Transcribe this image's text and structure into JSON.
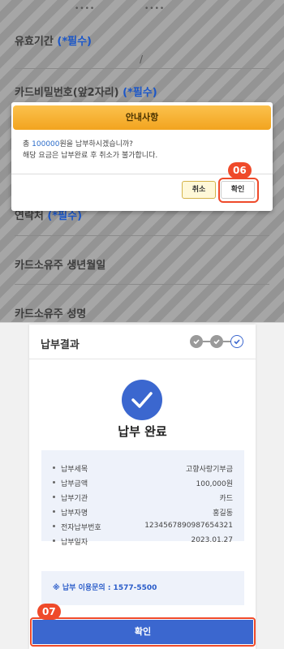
{
  "background_form": {
    "masked_values": [
      "••••",
      "••••"
    ],
    "fields": [
      {
        "label": "유효기간",
        "required": "(*필수)"
      },
      {
        "label": "카드비밀번호(앞2자리)",
        "required": "(*필수)"
      },
      {
        "label": "연락처",
        "required": "(*필수)"
      },
      {
        "label": "카드소유주 생년월일",
        "required": ""
      },
      {
        "label": "카드소유주 성명",
        "required": ""
      }
    ],
    "slash": "/"
  },
  "modal": {
    "title": "안내사항",
    "line1_prefix": "총 ",
    "line1_amount": "100000",
    "line1_suffix": "원을 납부하시겠습니까?",
    "line2": "해당 요금은 납부완료 후 취소가 불가합니다.",
    "cancel_label": "취소",
    "ok_label": "확인",
    "step_badge": "06"
  },
  "result": {
    "title": "납부결과",
    "complete_label": "납부 완료",
    "rows": [
      {
        "key": "납부세목",
        "value": "고향사랑기부금"
      },
      {
        "key": "납부금액",
        "value": "100,000원"
      },
      {
        "key": "납부기관",
        "value": "카드"
      },
      {
        "key": "납부자명",
        "value": "홍길동"
      },
      {
        "key": "전자납부번호",
        "value": "1234567890987654321"
      },
      {
        "key": "납부일자",
        "value": "2023.01.27"
      }
    ],
    "contact": "※ 납부 이용문의 : 1577-5500",
    "confirm_label": "확인",
    "step_badge": "07"
  },
  "colors": {
    "accent_blue": "#3b67cf",
    "modal_header": "#f2a41f",
    "highlight": "#ef4a2a"
  }
}
